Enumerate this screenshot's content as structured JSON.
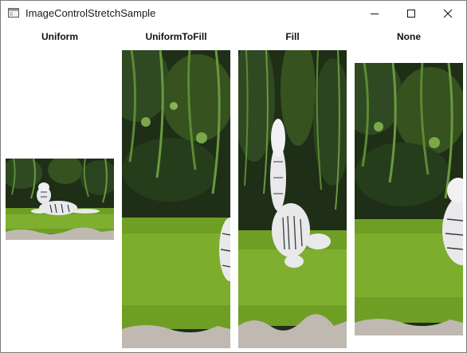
{
  "window": {
    "title": "ImageControlStretchSample",
    "app_icon": "app-window-icon",
    "buttons": {
      "minimize": "minimize-icon",
      "maximize": "maximize-icon",
      "close": "close-icon"
    }
  },
  "columns": [
    {
      "label": "Uniform"
    },
    {
      "label": "UniformToFill"
    },
    {
      "label": "Fill"
    },
    {
      "label": "None"
    }
  ],
  "image": {
    "subject": "white tiger lying on grass",
    "colors": {
      "foliage_dark": "#1f2e17",
      "foliage_light": "#5b8a34",
      "grass": "#6f9e24",
      "grass_light": "#8fbf3a",
      "rock": "#bfb9b2",
      "tiger": "#e9e9ec",
      "stripe": "#3a3a3a"
    }
  }
}
